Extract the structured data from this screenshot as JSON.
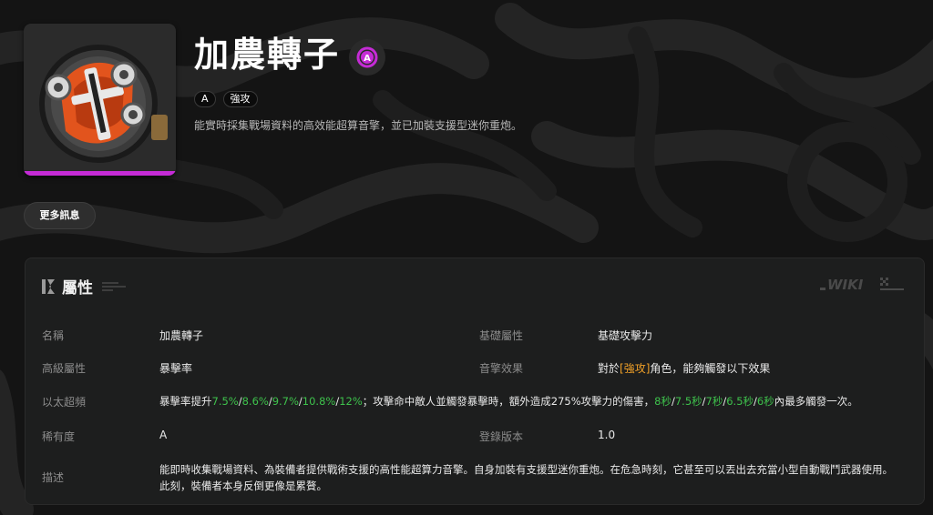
{
  "item": {
    "name": "加農轉子",
    "rank_icon": "A",
    "tags": [
      "A",
      "強攻"
    ],
    "subtitle": "能實時採集戰場資料的高效能超算音擎，並已加裝支援型迷你重炮。",
    "more_button": "更多訊息",
    "accent_color": "#c52bd6"
  },
  "panel": {
    "title": "屬性",
    "logo": "WIKI"
  },
  "attributes": {
    "name_label": "名稱",
    "name_value": "加農轉子",
    "base_label": "基礎屬性",
    "base_value": "基礎攻擊力",
    "adv_label": "高級屬性",
    "adv_value": "暴擊率",
    "effect_label": "音擎效果",
    "effect_prefix": "對於",
    "effect_tag": "[強攻]",
    "effect_suffix": "角色，能夠觸發以下效果",
    "passive_label": "以太超頻",
    "passive": {
      "prefix": "暴擊率提升",
      "v1": "7.5%",
      "v2": "8.6%",
      "v3": "9.7%",
      "v4": "10.8%",
      "v5": "12%",
      "middle": "；攻擊命中敵人並觸發暴擊時，額外造成275%攻擊力的傷害，",
      "c1": "8秒",
      "c2": "7.5秒",
      "c3": "7秒",
      "c4": "6.5秒",
      "c5": "6秒",
      "suffix": "內最多觸發一次。"
    },
    "rarity_label": "稀有度",
    "rarity_value": "A",
    "version_label": "登錄版本",
    "version_value": "1.0",
    "desc_label": "描述",
    "desc_line1": "能即時收集戰場資料、為裝備者提供戰術支援的高性能超算力音擎。自身加裝有支援型迷你重炮。在危急時刻，它甚至可以丟出去充當小型自動戰鬥武器使用。",
    "desc_line2": "此刻，裝備者本身反倒更像是累贅。"
  }
}
